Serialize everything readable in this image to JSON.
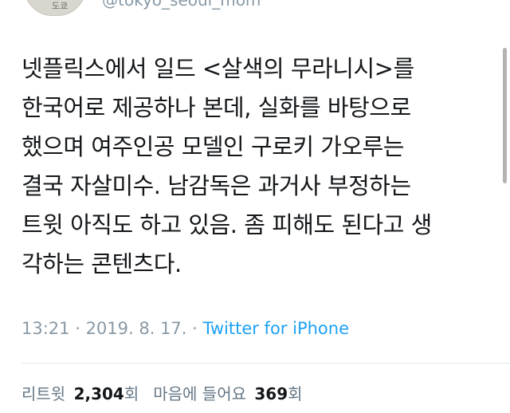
{
  "header": {
    "handle": "@tokyo_seoul_mom",
    "avatar_text": "도쿄"
  },
  "tweet": {
    "lines": [
      "넷플릭스에서 일드 <살색의 무라니시>를",
      "한국어로 제공하나 본데, 실화를 바탕으로",
      "했으며 여주인공 모델인 구로키 가오루는",
      "결국 자살미수. 남감독은 과거사 부정하는",
      "트윗 아직도 하고 있음. 좀 피해도 된다고 생",
      "각하는 콘텐츠다."
    ]
  },
  "meta": {
    "time": "13:21",
    "separator": " · ",
    "date": "2019. 8. 17.",
    "source": "Twitter for iPhone"
  },
  "stats": {
    "retweets_label": "리트윗",
    "retweets_count": "2,304",
    "retweets_unit": "회",
    "likes_label": "마음에 들어요",
    "likes_count": "369",
    "likes_unit": "회"
  },
  "colors": {
    "text": "#14171a",
    "muted": "#8899a6",
    "link": "#1da1f2"
  }
}
